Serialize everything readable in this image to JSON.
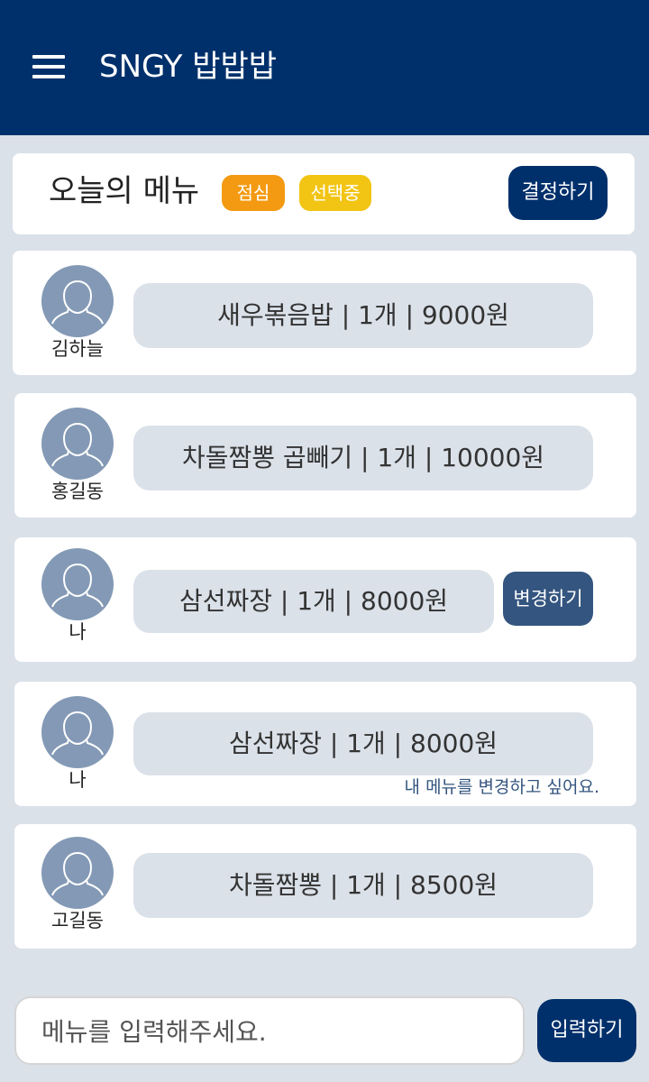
{
  "header": {
    "title": "SNGY 밥밥밥"
  },
  "todays_menu": {
    "title": "오늘의 메뉴",
    "meal_badge": "점심",
    "status_badge": "선택중",
    "decide_label": "결정하기"
  },
  "orders": [
    {
      "name": "김하늘",
      "order": "새우볶음밥 | 1개 | 9000원"
    },
    {
      "name": "홍길동",
      "order": "차돌짬뽕 곱빼기 | 1개 | 10000원"
    },
    {
      "name": "나",
      "order": "삼선짜장 | 1개 | 8000원",
      "change_label": "변경하기"
    },
    {
      "name": "나",
      "order": "삼선짜장 | 1개 | 8000원",
      "change_note": "내 메뉴를 변경하고 싶어요."
    },
    {
      "name": "고길동",
      "order": "차돌짬뽕 | 1개 | 8500원"
    }
  ],
  "input": {
    "placeholder": "메뉴를 입력해주세요.",
    "submit_label": "입력하기"
  },
  "colors": {
    "header_bg": "#00306b",
    "lunch_badge": "#f39a12",
    "status_badge": "#f2c413",
    "avatar_bg": "#8399b5",
    "change_button": "#34557f"
  }
}
